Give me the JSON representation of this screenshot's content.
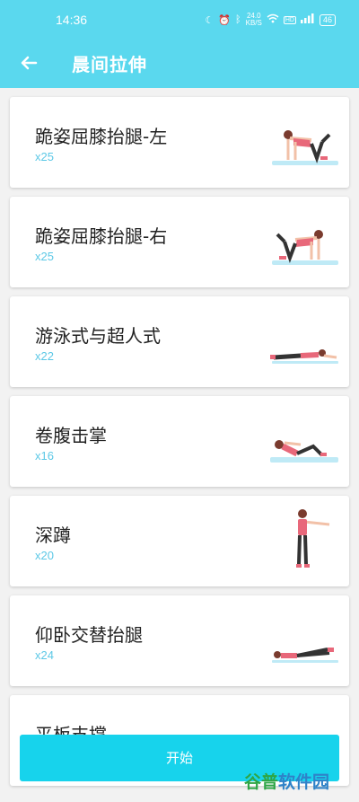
{
  "status_bar": {
    "time": "14:36",
    "net_speed": "24.0",
    "net_unit": "KB/S",
    "hd": "HD",
    "signal": "4G",
    "battery": "46"
  },
  "header": {
    "title": "晨间拉伸",
    "back_icon": "arrow-left-icon"
  },
  "exercises": [
    {
      "name": "跪姿屈膝抬腿-左",
      "reps": "x25"
    },
    {
      "name": "跪姿屈膝抬腿-右",
      "reps": "x25"
    },
    {
      "name": "游泳式与超人式",
      "reps": "x22"
    },
    {
      "name": "卷腹击掌",
      "reps": "x16"
    },
    {
      "name": "深蹲",
      "reps": "x20"
    },
    {
      "name": "仰卧交替抬腿",
      "reps": "x24"
    },
    {
      "name": "平板支撑",
      "reps": ""
    }
  ],
  "start_button": {
    "label": "开始"
  },
  "watermark": {
    "part1": "谷普",
    "part2": "软件园"
  },
  "colors": {
    "header_bg": "#5ad8ee",
    "accent": "#17d3ec",
    "reps_text": "#5cc8e6",
    "mat": "#bfeaf6",
    "outfit": "#e8687a"
  }
}
